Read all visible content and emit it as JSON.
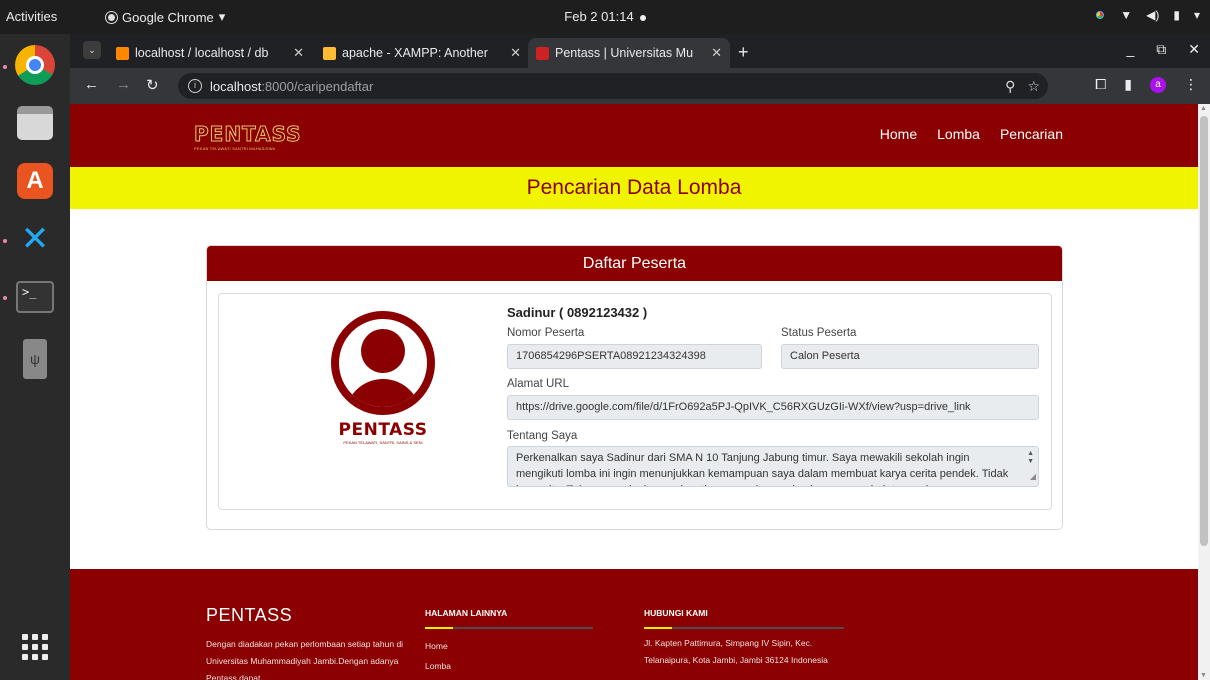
{
  "os": {
    "activities": "Activities",
    "app_name": "Google Chrome",
    "clock": "Feb 2  01:14"
  },
  "browser": {
    "tabs": [
      {
        "title": "localhost / localhost / db",
        "active": false
      },
      {
        "title": "apache - XAMPP: Another",
        "active": false
      },
      {
        "title": "Pentass | Universitas Mu",
        "active": true
      }
    ],
    "address_host": "localhost",
    "address_path": ":8000/caripendaftar"
  },
  "site": {
    "logo_text": "PENTASS",
    "logo_tagline": "PEKAN TELAWATI SANTRI MAHASISWA",
    "menu": [
      "Home",
      "Lomba",
      "Pencarian"
    ],
    "banner_title": "Pencarian Data Lomba",
    "card_title": "Daftar Peserta",
    "profile_logo": "PENTASS",
    "profile_logo_tagline": "PEKAN TELAWATI, SANTRI, SAINS & SENI"
  },
  "participant": {
    "name": "Sadinur ( 0892123432 )",
    "nomor_label": "Nomor Peserta",
    "nomor_value": "1706854296PSERTA08921234324398",
    "status_label": "Status Peserta",
    "status_value": "Calon Peserta",
    "url_label": "Alamat URL",
    "url_value": "https://drive.google.com/file/d/1FrO692a5PJ-QpIVK_C56RXGUzGIi-WXf/view?usp=drive_link",
    "about_label": "Tentang Saya",
    "about_value": "Perkenalkan saya Sadinur dari SMA N 10 Tanjung Jabung timur. Saya mewakili sekolah ingin mengikuti lomba ini ingin menunjukkan kemampuan saya dalam membuat karya cerita pendek. Tidak hanya itu. Tujuan saya ingin mendapatkan pengalaman dan juga menambah teman baru."
  },
  "footer": {
    "title": "PENTASS",
    "description": "Dengan diadakan pekan perlombaan setiap tahun di Universitas Muhammadiyah Jambi.Dengan adanya Pentass dapat",
    "links_heading": "HALAMAN LAINNYA",
    "links": [
      "Home",
      "Lomba"
    ],
    "contact_heading": "HUBUNGI KAMI",
    "contact_address": "Jl. Kapten Pattimura, Simpang IV Sipin, Kec. Telanaipura, Kota Jambi, Jambi 36124 Indonesia"
  },
  "colors": {
    "brand": "#8b0000",
    "banner": "#f0f400"
  }
}
